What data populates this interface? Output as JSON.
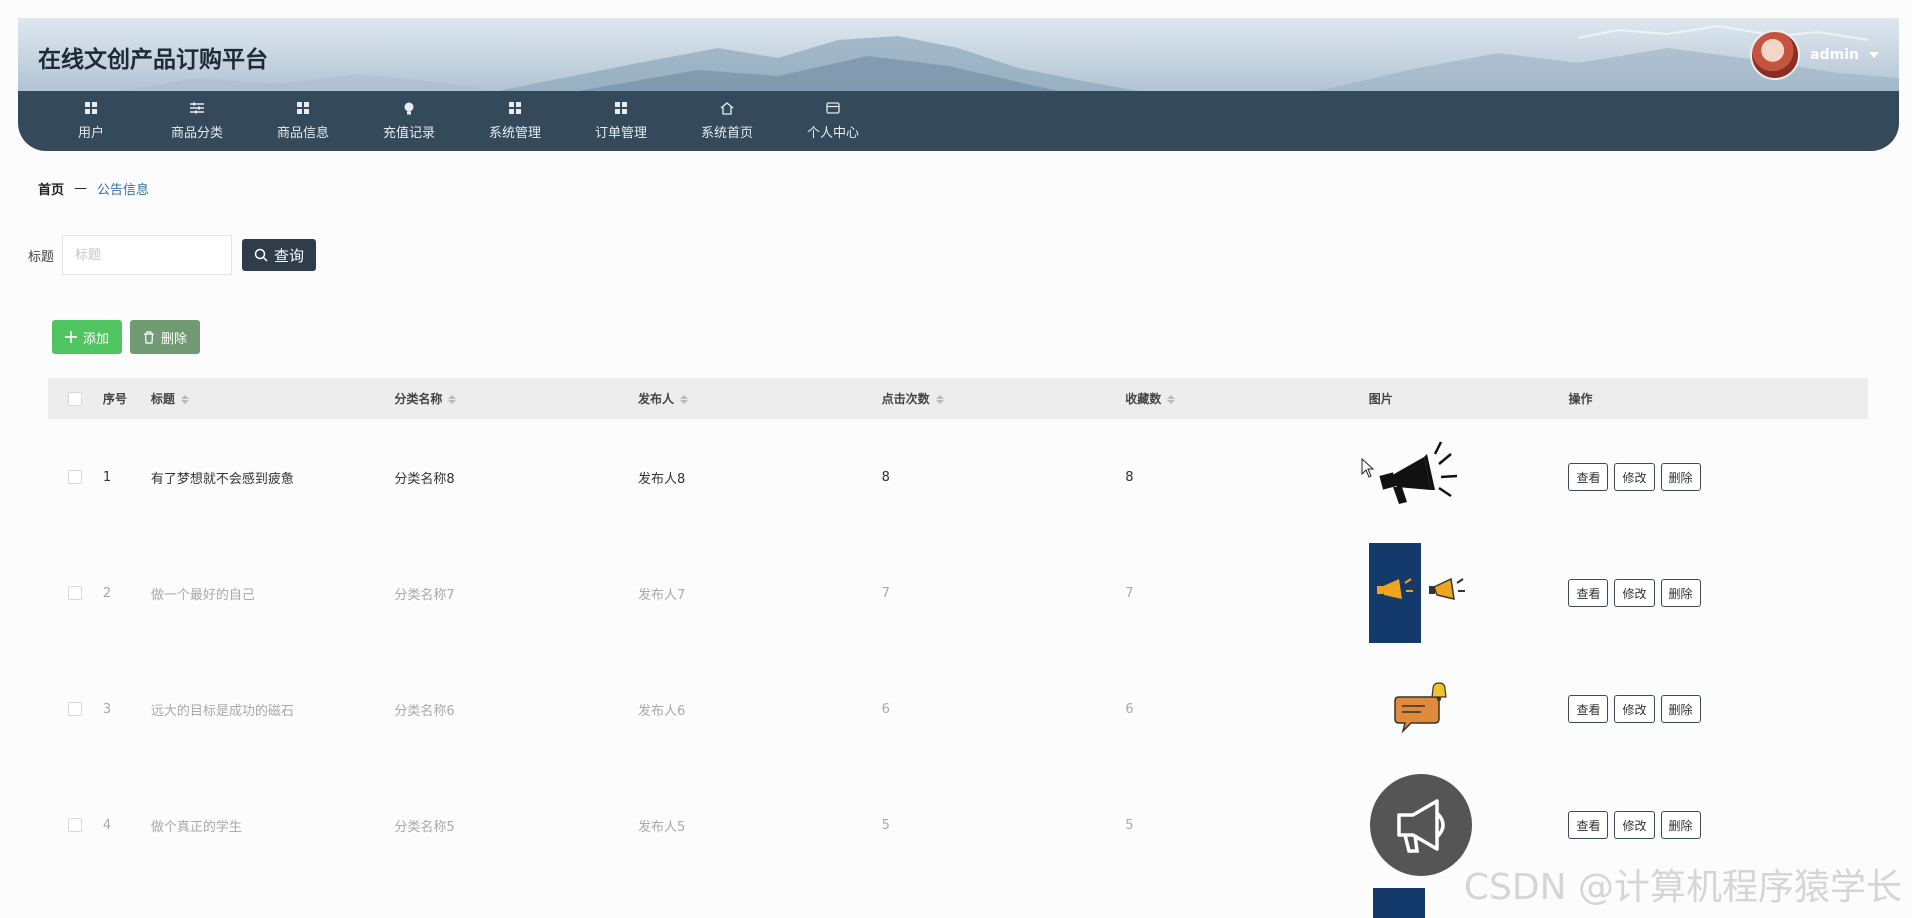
{
  "header": {
    "site_title": "在线文创产品订购平台",
    "user_name": "admin"
  },
  "nav": [
    {
      "label": "用户",
      "icon": "grid-icon"
    },
    {
      "label": "商品分类",
      "icon": "sliders-icon"
    },
    {
      "label": "商品信息",
      "icon": "grid-icon"
    },
    {
      "label": "充值记录",
      "icon": "bulb-icon"
    },
    {
      "label": "系统管理",
      "icon": "grid-icon"
    },
    {
      "label": "订单管理",
      "icon": "grid-icon"
    },
    {
      "label": "系统首页",
      "icon": "home-icon"
    },
    {
      "label": "个人中心",
      "icon": "wallet-icon"
    }
  ],
  "breadcrumb": {
    "home": "首页",
    "separator": "—",
    "current": "公告信息"
  },
  "search": {
    "label": "标题",
    "placeholder": "标题",
    "button": "查询"
  },
  "actions": {
    "add": "添加",
    "delete": "删除"
  },
  "table": {
    "headers": {
      "no": "序号",
      "title": "标题",
      "category": "分类名称",
      "publisher": "发布人",
      "clicks": "点击次数",
      "favorites": "收藏数",
      "image": "图片",
      "operation": "操作"
    },
    "rows": [
      {
        "no": "1",
        "title": "有了梦想就不会感到疲惫",
        "category": "分类名称8",
        "publisher": "发布人8",
        "clicks": "8",
        "favorites": "8",
        "image": "megaphone-black-icon"
      },
      {
        "no": "2",
        "title": "做一个最好的自己",
        "category": "分类名称7",
        "publisher": "发布人7",
        "clicks": "7",
        "favorites": "7",
        "image": "megaphone-gold-icon"
      },
      {
        "no": "3",
        "title": "远大的目标是成功的磁石",
        "category": "分类名称6",
        "publisher": "发布人6",
        "clicks": "6",
        "favorites": "6",
        "image": "chat-bell-icon"
      },
      {
        "no": "4",
        "title": "做个真正的学生",
        "category": "分类名称5",
        "publisher": "发布人5",
        "clicks": "5",
        "favorites": "5",
        "image": "megaphone-circle-icon"
      }
    ],
    "ops": {
      "view": "查看",
      "edit": "修改",
      "delete": "删除"
    }
  },
  "watermark": "CSDN @计算机程序猿学长",
  "colors": {
    "nav_bg": "#34495a",
    "query_btn": "#2f3d4b",
    "add_btn": "#4fc461",
    "delete_btn": "#6f9a72",
    "link": "#2f6fa3"
  }
}
